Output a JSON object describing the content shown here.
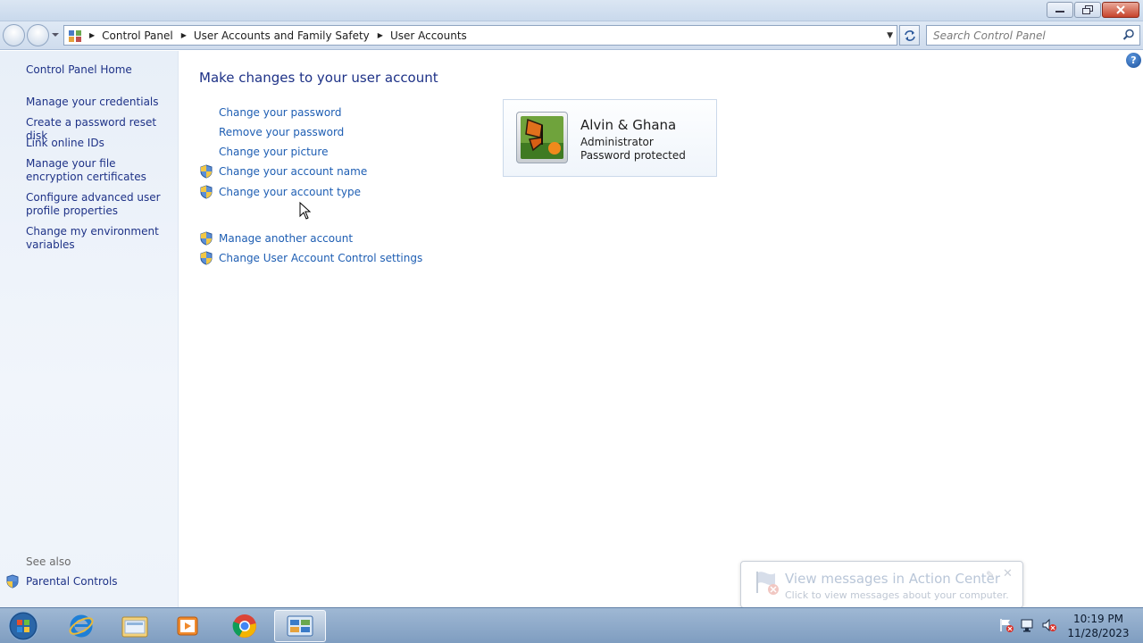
{
  "window": {
    "controls": [
      "minimize",
      "maximize",
      "close"
    ]
  },
  "nav": {
    "breadcrumbs": [
      "Control Panel",
      "User Accounts and Family Safety",
      "User Accounts"
    ],
    "search_placeholder": "Search Control Panel"
  },
  "sidebar": {
    "home": "Control Panel Home",
    "links": [
      "Manage your credentials",
      "Create a password reset disk",
      "Link online IDs",
      "Manage your file encryption certificates",
      "Configure advanced user profile properties",
      "Change my environment variables"
    ],
    "see_also_label": "See also",
    "see_also_links": [
      "Parental Controls"
    ]
  },
  "main": {
    "heading": "Make changes to your user account",
    "tasks": [
      "Change your password",
      "Remove your password",
      "Change your picture",
      "Change your account name",
      "Change your account type"
    ],
    "other_tasks": [
      "Manage another account",
      "Change User Account Control settings"
    ]
  },
  "account": {
    "name": "Alvin & Ghana",
    "type": "Administrator",
    "status": "Password protected"
  },
  "notification": {
    "title": "View messages in Action Center",
    "text": "Click to view messages about your computer."
  },
  "taskbar": {
    "time": "10:19 PM",
    "date": "11/28/2023",
    "icons": [
      "start-orb",
      "internet-explorer-icon",
      "file-explorer-icon",
      "media-player-icon",
      "chrome-icon",
      "control-panel-icon"
    ]
  }
}
